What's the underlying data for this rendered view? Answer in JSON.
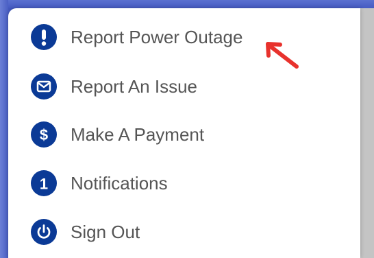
{
  "menu": {
    "items": [
      {
        "icon": "exclamation-icon",
        "label": "Report Power Outage"
      },
      {
        "icon": "envelope-icon",
        "label": "Report An Issue"
      },
      {
        "icon": "dollar-icon",
        "label": "Make A Payment"
      },
      {
        "icon": "number-one-icon",
        "label": "Notifications"
      },
      {
        "icon": "power-icon",
        "label": "Sign Out"
      }
    ]
  },
  "colors": {
    "icon_bg": "#0b3a96",
    "label_text": "#555555",
    "annotation_arrow": "#e8322d",
    "background_blue": "#3a4fb8"
  }
}
